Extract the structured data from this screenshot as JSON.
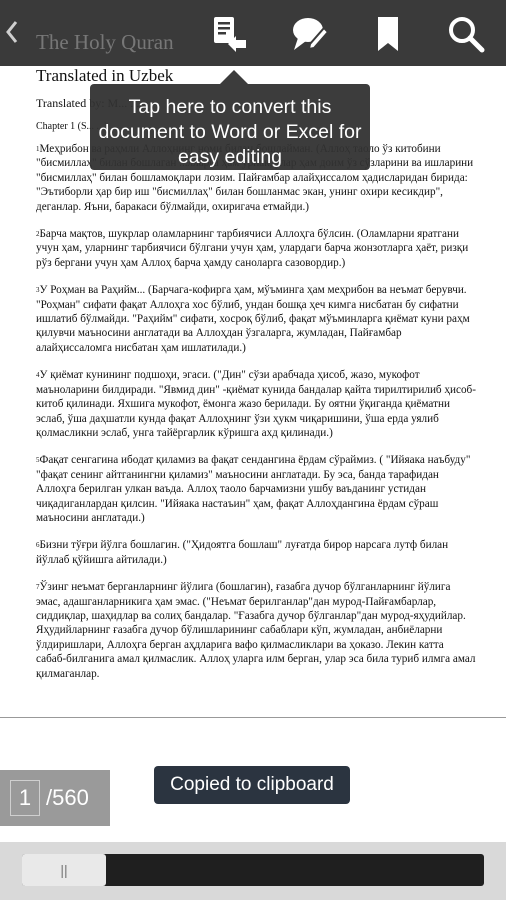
{
  "toolbar": {
    "back_glyph": "‹",
    "icons": [
      "convert-document-icon",
      "comment-icon",
      "bookmark-icon",
      "search-icon"
    ],
    "bg_color": "#3a3a3a"
  },
  "document": {
    "title": "The Holy Quran",
    "subtitle": "Translated in Uzbek",
    "translated_by": "Translated by: M... ...",
    "chapter": "Chapter 1 (S... ...)",
    "verses": [
      {
        "num": "1",
        "text": "Меҳрибон ва раҳмли Аллоҳнинг номи билан бошлайман. (Аллоҳ таоло ўз китобини \"бисмиллаҳ\" билан бошлаган ...лларга ҳам ўрнак, улар ҳам доим ўз сўзларини ва ишларини \"бисмиллаҳ\" билан бошламоқлари лозим. Пайғамбар алайҳиссалом ҳадисларидан бирида: \"Эътиборли ҳар бир иш \"бисмиллаҳ\" билан бошланмас экан, унинг охири кесикдир\", деганлар. Яъни, баракаси бўлмайди, охиригача етмайди.)"
      },
      {
        "num": "2",
        "text": "Барча мақтов, шукрлар оламларнинг тарбиячиси Аллоҳга бўлсин. (Оламларни яратгани учун ҳам, уларнинг тарбиячиси бўлгани учун ҳам, улардаги барча жонзотларга ҳаёт, ризқи рўз бергани учун ҳам Аллоҳ барча ҳамду саноларга сазовордир.)"
      },
      {
        "num": "3",
        "text": "У Роҳман ва Раҳийм... (Барчага-кофирга ҳам, мўъминга ҳам меҳрибон ва неъмат берувчи. \"Роҳман\" сифати фақат Аллоҳга хос бўлиб, ундан бошқа ҳеч кимга нисбатан бу сифатни ишлатиб бўлмайди. \"Раҳийм\" сифати, хосроқ бўлиб, фақат мўъминларга қиёмат куни раҳм қилувчи маъносини англатади ва Аллоҳдан ўзгаларга, жумладан, Пайғамбар алайҳиссаломга нисбатан ҳам ишлатилади.)"
      },
      {
        "num": "4",
        "text": "У қиёмат кунининг подшоҳи, эгаси. (\"Дин\" сўзи арабчада ҳисоб, жазо, мукофот маъноларини билдиради. \"Явмид дин\" -қиёмат кунида бандалар қайта тирилтирилиб ҳисоб-китоб қилинади. Яхшига мукофот, ёмонга жазо берилади. Бу оятни ўқиганда қиёматни эслаб, ўша даҳшатли кунда фақат Аллоҳнинг ўзи ҳукм чиқаришини, ўша ерда уялиб қолмасликни эслаб, унга тайёргарлик кўришга ахд қилинади.)"
      },
      {
        "num": "5",
        "text": "Фақат сенгагина ибодат қиламиз ва фақат сендангина ёрдам сўраймиз. ( \"Ийяака наъбуду\" \"фақат сенинг айтганингни қиламиз\" маъносини англатади. Бу эса, банда тарафидан Аллоҳга берилган улкан ваъда. Аллоҳ таоло барчамизни ушбу ваъданинг устидан чиқадиганлардан қилсин. \"Ийяака настаъин\" ҳам, фақат Аллоҳдангина ёрдам сўраш маъносини англатади.)"
      },
      {
        "num": "6",
        "text": "Бизни тўғри йўлга бошлагин. (\"Ҳидоятга бошлаш\" луғатда бирор нарсага лутф билан йўллаб қўйишга айтилади.)"
      },
      {
        "num": "7",
        "text": "Ўзинг неъмат берганларнинг йўлига (бошлагин), ғазабга дучор бўлганларнинг йўлига эмас, адашганларникига ҳам эмас. (\"Неъмат берилганлар\"дан мурод-Пайғамбарлар, сиддиқлар, шаҳидлар ва солиҳ бандалар. \"Ғазабга дучор бўлганлар\"дан мурод-яҳудийлар. Яҳудийларнинг ғазабга дучор бўлишларининг сабаблари кўп, жумладан, анбиёларни ўлдиришлари, Аллоҳга берган аҳдларига вафо қилмасликлари ва ҳоказо. Лекин катта сабаб-билганига амал қилмаслик. Аллоҳ уларга илм берган, улар эса била туриб илмга амал қилмаганлар."
      }
    ]
  },
  "tooltip": {
    "text": "Tap here to convert this document to Word or Excel for easy editing"
  },
  "pagination": {
    "current": "1",
    "total": "/560"
  },
  "toast": {
    "text": "Copied to clipboard"
  },
  "scrollbar": {
    "thumb_glyph": "||",
    "position_fraction": 0.0
  }
}
